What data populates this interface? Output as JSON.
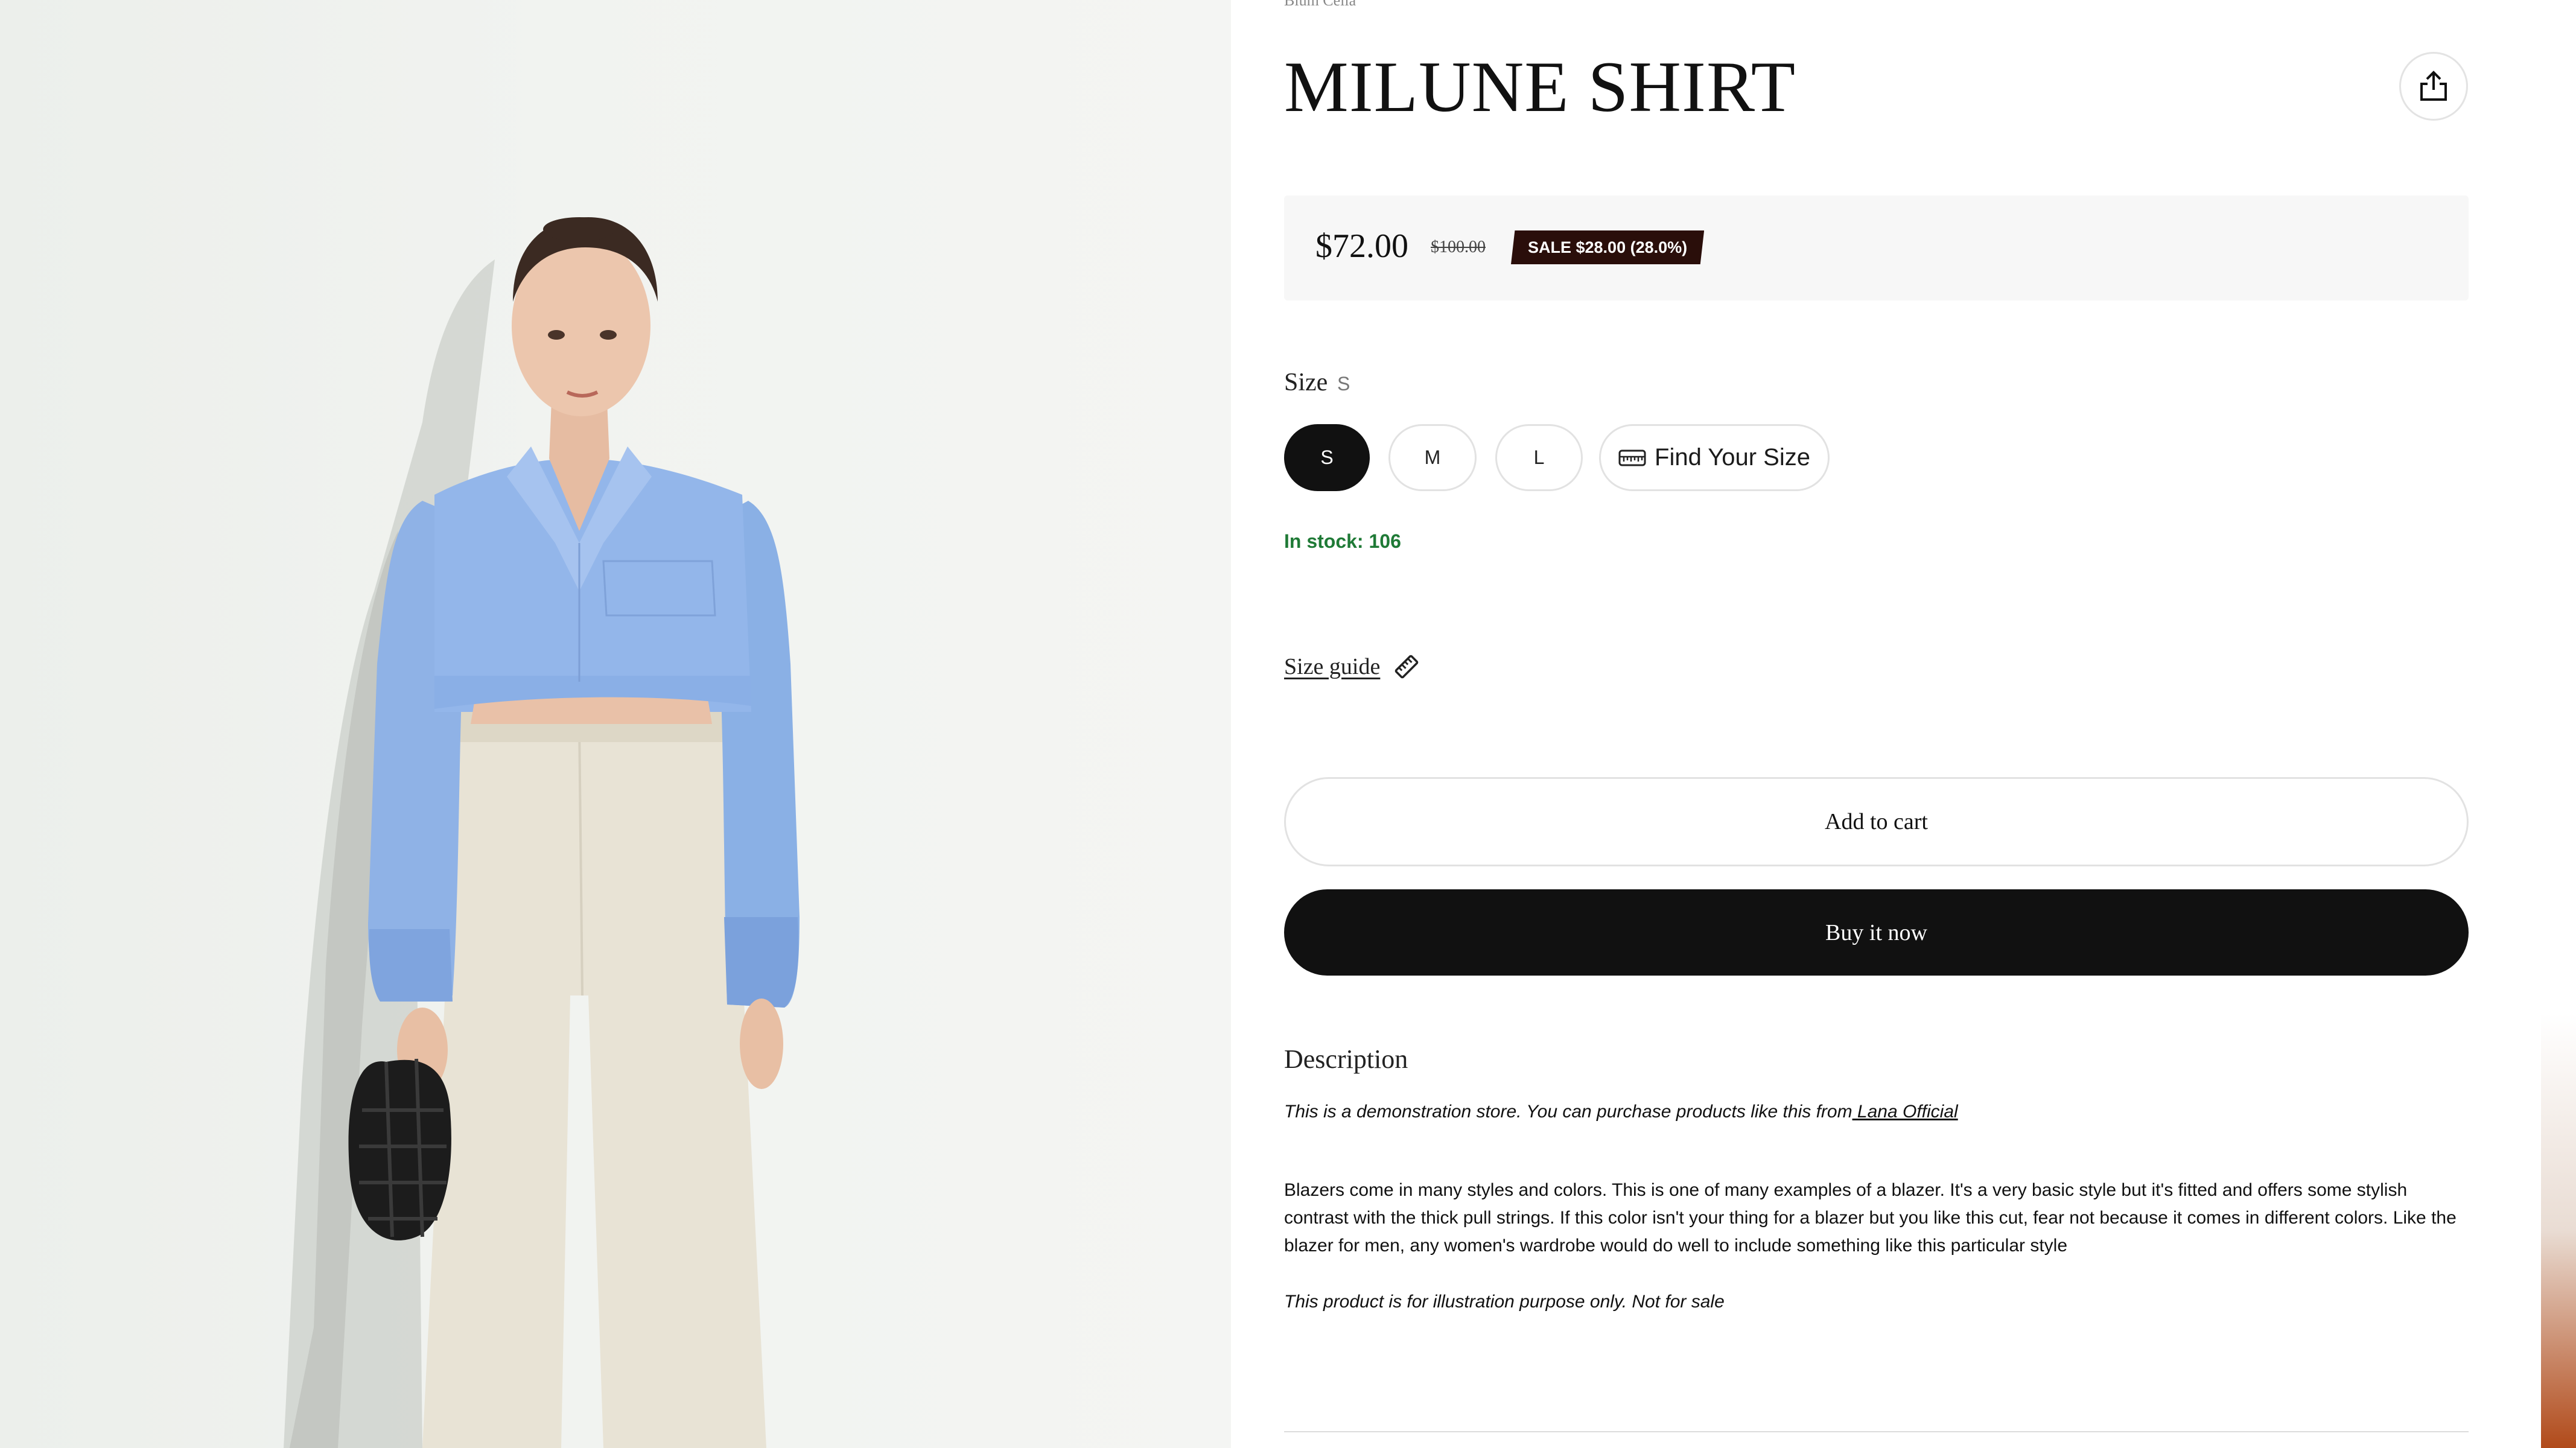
{
  "product": {
    "vendor": "Blum Cella",
    "title": "MILUNE SHIRT",
    "price": "$72.00",
    "compare_price": "$100.00",
    "sale_badge": "SALE $28.00 (28.0%)"
  },
  "size": {
    "label": "Size",
    "selected": "S",
    "options": [
      "S",
      "M",
      "L"
    ],
    "find_your_size": "Find Your Size"
  },
  "stock": "In stock: 106",
  "size_guide": "Size guide",
  "actions": {
    "add_to_cart": "Add to cart",
    "buy_now": "Buy it now"
  },
  "description": {
    "heading": "Description",
    "note_prefix": "This is a demonstration store. You can purchase products like this from",
    "note_link": " Lana Official",
    "body": "Blazers come in many styles and colors. This is one of many examples of a blazer. It's a very basic style but it's fitted and offers some stylish contrast with the thick pull strings. If this color isn't your thing for a blazer but you like this cut, fear not because it comes in different colors. Like the blazer for men, any women's wardrobe would do well to include something like this particular style",
    "footer": "This product is for illustration purpose only. Not for sale"
  },
  "icons": {
    "share": "share-icon",
    "find_size": "measuring-tape-icon",
    "size_guide": "ruler-icon"
  },
  "colors": {
    "accent": "#111111",
    "sale_badge_bg": "#2a0e0a",
    "stock": "#1f7a36",
    "shirt": "#8fb3e8",
    "pants": "#e8e2d4"
  }
}
